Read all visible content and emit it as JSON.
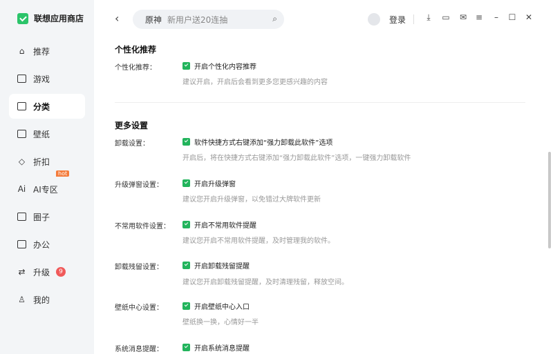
{
  "app": {
    "title": "联想应用商店",
    "accent": "#22b45c"
  },
  "sidebar": {
    "items": [
      {
        "label": "推荐",
        "icon": "home-icon"
      },
      {
        "label": "游戏",
        "icon": "game-icon"
      },
      {
        "label": "分类",
        "icon": "category-icon",
        "active": true
      },
      {
        "label": "壁纸",
        "icon": "wallpaper-icon"
      },
      {
        "label": "折扣",
        "icon": "tag-icon"
      },
      {
        "label": "AI专区",
        "icon": "ai-icon",
        "tag": "hot"
      },
      {
        "label": "圈子",
        "icon": "community-icon"
      },
      {
        "label": "办公",
        "icon": "briefcase-icon"
      },
      {
        "label": "升级",
        "icon": "upgrade-icon",
        "badge": "9"
      },
      {
        "label": "我的",
        "icon": "user-icon"
      }
    ]
  },
  "header": {
    "search_keyword": "原神",
    "search_placeholder": "新用户送20连抽",
    "login": "登录"
  },
  "sections": {
    "personal": {
      "title": "个性化推荐",
      "rows": [
        {
          "label": "个性化推荐：",
          "option": "开启个性化内容推荐",
          "desc": "建议开启，开启后会看到更多您更感兴趣的内容"
        }
      ]
    },
    "more": {
      "title": "更多设置",
      "rows": [
        {
          "label": "卸载设置：",
          "option": "软件快捷方式右键添加“强力卸载此软件”选项",
          "desc": "开启后，将在快捷方式右键添加“强力卸载此软件”选项，一键强力卸载软件"
        },
        {
          "label": "升级弹窗设置：",
          "option": "开启升级弹窗",
          "desc": "建议您开启升级弹窗，以免错过大牌软件更新"
        },
        {
          "label": "不常用软件设置：",
          "option": "开启不常用软件提醒",
          "desc": "建议您开启不常用软件提醒，及时管理我的软件。"
        },
        {
          "label": "卸载残留设置：",
          "option": "开启卸载残留提醒",
          "desc": "建议您开启卸载残留提醒，及时清理残留，释放空间。"
        },
        {
          "label": "壁纸中心设置：",
          "option": "开启壁纸中心入口",
          "desc": "壁纸换一换，心情好一半"
        },
        {
          "label": "系统消息提醒：",
          "option": "开启系统消息提醒"
        }
      ]
    }
  }
}
